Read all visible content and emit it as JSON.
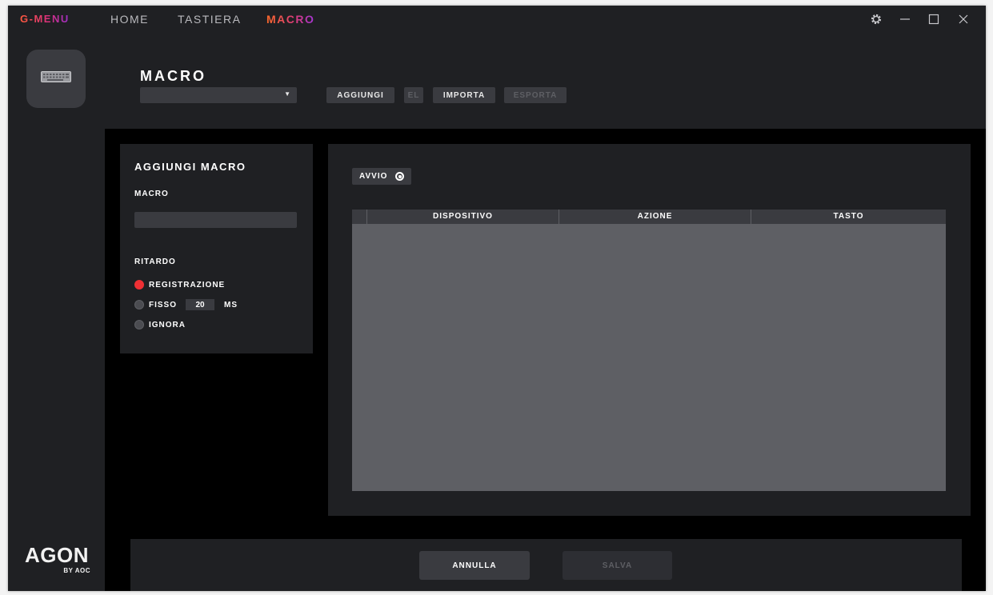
{
  "app": {
    "brand": "G-MENU",
    "nav": [
      "HOME",
      "TASTIERA",
      "MACRO"
    ],
    "active_nav": "MACRO",
    "window_controls": [
      "gear-icon",
      "minimize-icon",
      "maximize-icon",
      "close-icon"
    ]
  },
  "sidebar": {
    "device_icon": "keyboard-icon",
    "logo_main": "AGON",
    "logo_sub": "BY AOC"
  },
  "header": {
    "title": "MACRO",
    "macro_select_value": "",
    "buttons": {
      "add": "AGGIUNGI",
      "el": "EL",
      "import": "IMPORTA",
      "export": "ESPORTA"
    }
  },
  "add_panel": {
    "title": "AGGIUNGI MACRO",
    "macro_label": "MACRO",
    "macro_value": "",
    "delay_label": "RITARDO",
    "options": {
      "record": "REGISTRAZIONE",
      "fixed": "FISSO",
      "ignore": "IGNORA"
    },
    "selected_option": "REGISTRAZIONE",
    "fixed_value": "20",
    "fixed_unit": "MS"
  },
  "editor": {
    "start_label": "AVVIO",
    "columns": [
      "",
      "DISPOSITIVO",
      "AZIONE",
      "TASTO"
    ],
    "rows": []
  },
  "footer": {
    "cancel": "ANNULLA",
    "save": "SALVA"
  },
  "colors": {
    "accent_red": "#ef3034",
    "panel": "#1f2023",
    "control": "#3a3b40",
    "table_body": "#5e5f64"
  }
}
